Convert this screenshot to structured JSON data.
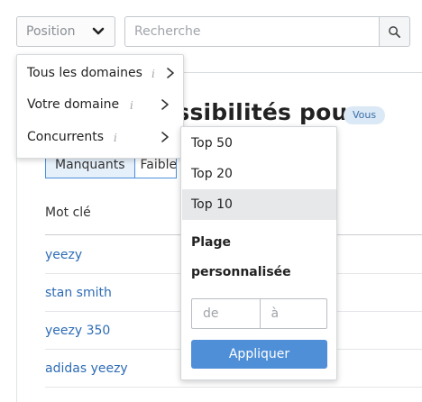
{
  "toolbar": {
    "position_label": "Position",
    "search_placeholder": "Recherche"
  },
  "background": {
    "heading": "ossibilités pour",
    "badge": "Vous",
    "tabs": [
      "Manquants",
      "Faibles"
    ],
    "column_header": "Mot clé",
    "keywords": [
      "yeezy",
      "stan smith",
      "yeezy 350",
      "adidas yeezy"
    ]
  },
  "position_menu": {
    "items": [
      {
        "label": "Tous les domaines",
        "info": "i"
      },
      {
        "label": "Votre domaine",
        "info": "i"
      },
      {
        "label": "Concurrents",
        "info": "i"
      }
    ]
  },
  "top_menu": {
    "options": [
      "Top 50",
      "Top 20",
      "Top 10"
    ],
    "selected": "Top 10",
    "custom_label_line1": "Plage",
    "custom_label_line2": "personnalisée",
    "from_placeholder": "de",
    "to_placeholder": "à",
    "apply_label": "Appliquer"
  },
  "colors": {
    "accent": "#4f8fd8",
    "link": "#2e6cb5",
    "badge_bg": "#dbe8f6"
  },
  "icons": {
    "position_chevron": "chevron-down-icon",
    "search": "search-icon",
    "submenu_arrow": "chevron-right-icon",
    "info": "info-icon"
  }
}
